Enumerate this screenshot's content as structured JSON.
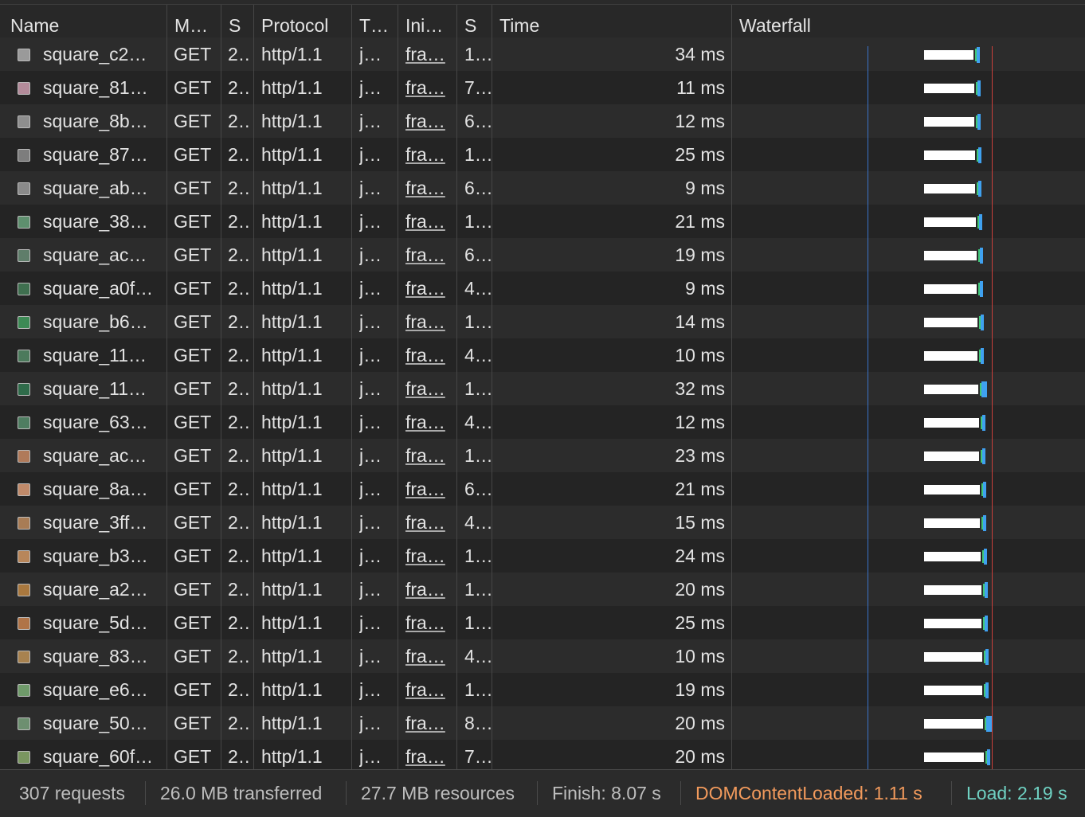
{
  "columns": [
    {
      "key": "name",
      "label": "Name"
    },
    {
      "key": "method",
      "label": "M…"
    },
    {
      "key": "status",
      "label": "S"
    },
    {
      "key": "protocol",
      "label": "Protocol"
    },
    {
      "key": "type",
      "label": "T…"
    },
    {
      "key": "initiator",
      "label": "Ini…"
    },
    {
      "key": "size",
      "label": "S"
    },
    {
      "key": "time",
      "label": "Time"
    },
    {
      "key": "waterfall",
      "label": "Waterfall"
    }
  ],
  "rows": [
    {
      "name": "square_c2…",
      "method": "GET",
      "status": "2…",
      "protocol": "http/1.1",
      "type": "j…",
      "initiator": "fra…",
      "size": "1…",
      "time": "34 ms",
      "thumb": "#9a9a9a"
    },
    {
      "name": "square_81…",
      "method": "GET",
      "status": "2…",
      "protocol": "http/1.1",
      "type": "j…",
      "initiator": "fra…",
      "size": "7…",
      "time": "11 ms",
      "thumb": "#b38b9a"
    },
    {
      "name": "square_8b…",
      "method": "GET",
      "status": "2…",
      "protocol": "http/1.1",
      "type": "j…",
      "initiator": "fra…",
      "size": "6…",
      "time": "12 ms",
      "thumb": "#8e8e8e"
    },
    {
      "name": "square_87…",
      "method": "GET",
      "status": "2…",
      "protocol": "http/1.1",
      "type": "j…",
      "initiator": "fra…",
      "size": "1…",
      "time": "25 ms",
      "thumb": "#7d7d7d"
    },
    {
      "name": "square_ab…",
      "method": "GET",
      "status": "2…",
      "protocol": "http/1.1",
      "type": "j…",
      "initiator": "fra…",
      "size": "6…",
      "time": "9 ms",
      "thumb": "#8a8a8a"
    },
    {
      "name": "square_38…",
      "method": "GET",
      "status": "2…",
      "protocol": "http/1.1",
      "type": "j…",
      "initiator": "fra…",
      "size": "1…",
      "time": "21 ms",
      "thumb": "#5e8f6e"
    },
    {
      "name": "square_ac…",
      "method": "GET",
      "status": "2…",
      "protocol": "http/1.1",
      "type": "j…",
      "initiator": "fra…",
      "size": "6…",
      "time": "19 ms",
      "thumb": "#5f7d6a"
    },
    {
      "name": "square_a0f…",
      "method": "GET",
      "status": "2…",
      "protocol": "http/1.1",
      "type": "j…",
      "initiator": "fra…",
      "size": "4…",
      "time": "9 ms",
      "thumb": "#3f6f4f"
    },
    {
      "name": "square_b6…",
      "method": "GET",
      "status": "2…",
      "protocol": "http/1.1",
      "type": "j…",
      "initiator": "fra…",
      "size": "1…",
      "time": "14 ms",
      "thumb": "#3d8a55"
    },
    {
      "name": "square_11…",
      "method": "GET",
      "status": "2…",
      "protocol": "http/1.1",
      "type": "j…",
      "initiator": "fra…",
      "size": "4…",
      "time": "10 ms",
      "thumb": "#4c7a5c"
    },
    {
      "name": "square_11…",
      "method": "GET",
      "status": "2…",
      "protocol": "http/1.1",
      "type": "j…",
      "initiator": "fra…",
      "size": "1…",
      "time": "32 ms",
      "thumb": "#2f6b4a"
    },
    {
      "name": "square_63…",
      "method": "GET",
      "status": "2…",
      "protocol": "http/1.1",
      "type": "j…",
      "initiator": "fra…",
      "size": "4…",
      "time": "12 ms",
      "thumb": "#4f7d61"
    },
    {
      "name": "square_ac…",
      "method": "GET",
      "status": "2…",
      "protocol": "http/1.1",
      "type": "j…",
      "initiator": "fra…",
      "size": "1…",
      "time": "23 ms",
      "thumb": "#b07a5a"
    },
    {
      "name": "square_8a…",
      "method": "GET",
      "status": "2…",
      "protocol": "http/1.1",
      "type": "j…",
      "initiator": "fra…",
      "size": "6…",
      "time": "21 ms",
      "thumb": "#c08a6a"
    },
    {
      "name": "square_3ff…",
      "method": "GET",
      "status": "2…",
      "protocol": "http/1.1",
      "type": "j…",
      "initiator": "fra…",
      "size": "4…",
      "time": "15 ms",
      "thumb": "#a87c55"
    },
    {
      "name": "square_b3…",
      "method": "GET",
      "status": "2…",
      "protocol": "http/1.1",
      "type": "j…",
      "initiator": "fra…",
      "size": "1…",
      "time": "24 ms",
      "thumb": "#b8865a"
    },
    {
      "name": "square_a2…",
      "method": "GET",
      "status": "2…",
      "protocol": "http/1.1",
      "type": "j…",
      "initiator": "fra…",
      "size": "1…",
      "time": "20 ms",
      "thumb": "#a9783e"
    },
    {
      "name": "square_5d…",
      "method": "GET",
      "status": "2…",
      "protocol": "http/1.1",
      "type": "j…",
      "initiator": "fra…",
      "size": "1…",
      "time": "25 ms",
      "thumb": "#b07448"
    },
    {
      "name": "square_83…",
      "method": "GET",
      "status": "2…",
      "protocol": "http/1.1",
      "type": "j…",
      "initiator": "fra…",
      "size": "4…",
      "time": "10 ms",
      "thumb": "#a8824f"
    },
    {
      "name": "square_e6…",
      "method": "GET",
      "status": "2…",
      "protocol": "http/1.1",
      "type": "j…",
      "initiator": "fra…",
      "size": "1…",
      "time": "19 ms",
      "thumb": "#6f9a6a"
    },
    {
      "name": "square_50…",
      "method": "GET",
      "status": "2…",
      "protocol": "http/1.1",
      "type": "j…",
      "initiator": "fra…",
      "size": "8…",
      "time": "20 ms",
      "thumb": "#6d8f70"
    },
    {
      "name": "square_60f…",
      "method": "GET",
      "status": "2…",
      "protocol": "http/1.1",
      "type": "j…",
      "initiator": "fra…",
      "size": "7…",
      "time": "20 ms",
      "thumb": "#7a9660"
    }
  ],
  "footer": {
    "requests": "307 requests",
    "transferred": "26.0 MB transferred",
    "resources": "27.7 MB resources",
    "finish": "Finish: 8.07 s",
    "dom_content_loaded": "DOMContentLoaded: 1.11 s",
    "load": "Load: 2.19 s"
  },
  "colors": {
    "dom_content_loaded": "#f29a5c",
    "load": "#6fd1c2",
    "waterfall_receive": "#3fa1f0",
    "waterfall_wait": "#ffffff"
  }
}
